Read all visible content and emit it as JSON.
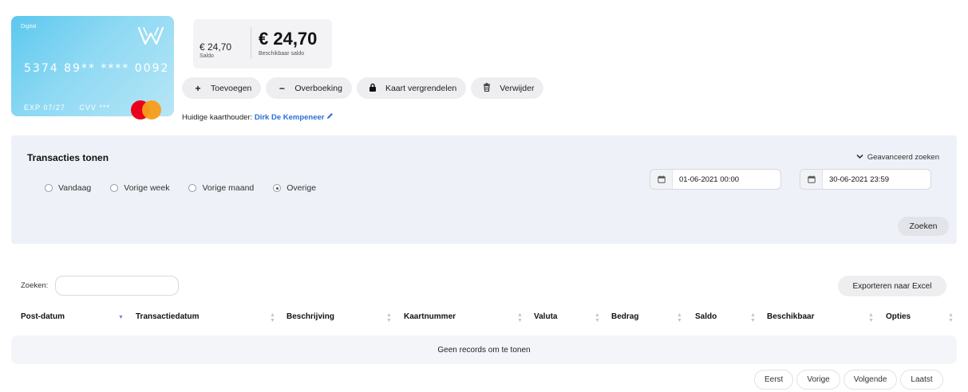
{
  "card": {
    "label": "Digital",
    "number": "5374 89** **** 0092",
    "exp": "EXP 07/27",
    "cvv": "CVV ***",
    "brand_logo": "mastercard-logo",
    "issuer_logo": "w-logo"
  },
  "balance": {
    "saldo_value": "€ 24,70",
    "saldo_label": "Saldo",
    "available_value": "€ 24,70",
    "available_label": "Beschikbaar saldo"
  },
  "actions": [
    {
      "icon": "plus-icon",
      "glyph": "+",
      "label": "Toevoegen"
    },
    {
      "icon": "minus-icon",
      "glyph": "−",
      "label": "Overboeking"
    },
    {
      "icon": "lock-icon",
      "glyph": "",
      "label": "Kaart vergrendelen"
    },
    {
      "icon": "trash-icon",
      "glyph": "",
      "label": "Verwijder"
    }
  ],
  "holder": {
    "label": "Huidige kaarthouder:",
    "name": "Dirk De Kempeneer"
  },
  "filter": {
    "title": "Transacties tonen",
    "advanced_label": "Geavanceerd zoeken",
    "options": [
      "Vandaag",
      "Vorige week",
      "Vorige maand",
      "Overige"
    ],
    "selected": "Overige",
    "date_from": "01-06-2021 00:00",
    "date_to": "30-06-2021 23:59",
    "search_button": "Zoeken"
  },
  "table": {
    "search_label": "Zoeken:",
    "search_value": "",
    "export_button": "Exporteren naar Excel",
    "columns": [
      "Post-datum",
      "Transactiedatum",
      "Beschrijving",
      "Kaartnummer",
      "Valuta",
      "Bedrag",
      "Saldo",
      "Beschikbaar",
      "Opties"
    ],
    "empty_message": "Geen records om te tonen",
    "pagination": [
      "Eerst",
      "Vorige",
      "Volgende",
      "Laatst"
    ]
  },
  "colors": {
    "card_gradient_start": "#5cc8ee",
    "link": "#2a6fd6",
    "panel_bg": "#eef1f7",
    "sort_active": "#7e7ae8"
  }
}
